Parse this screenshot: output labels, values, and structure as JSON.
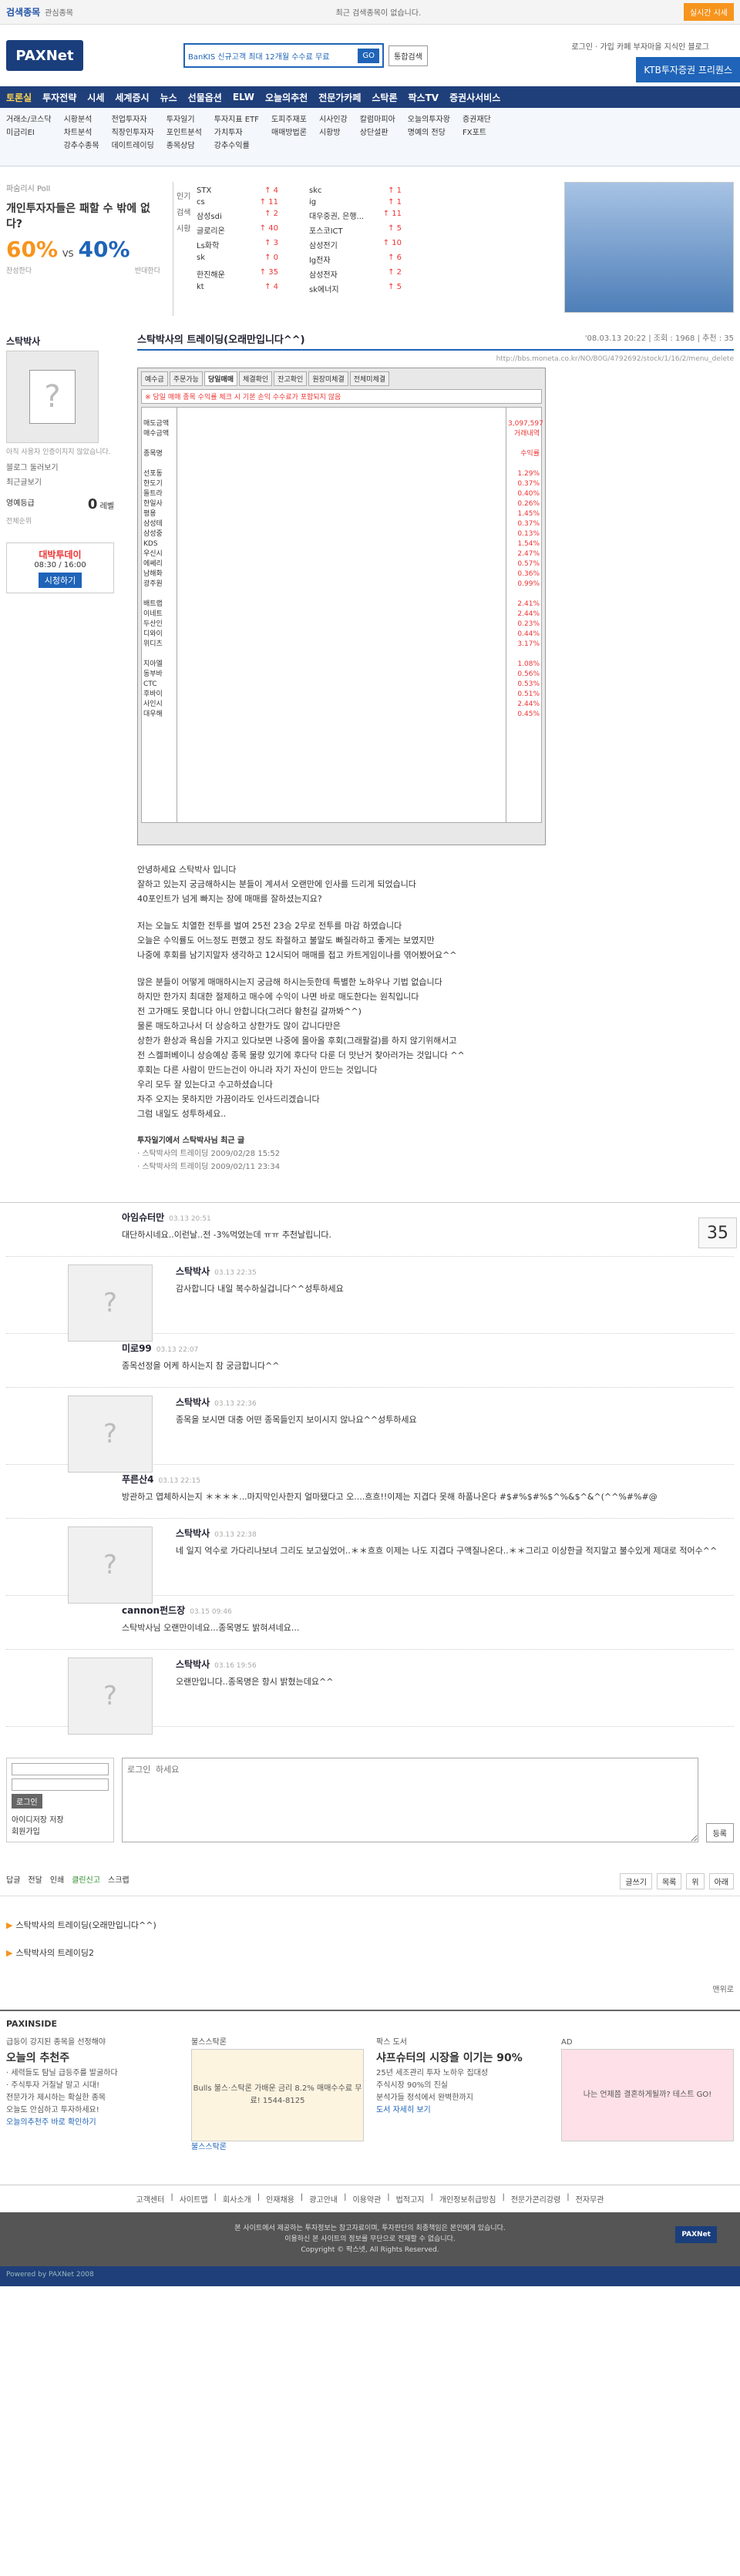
{
  "top": {
    "brand": "검색종목",
    "brand_sub": "관심종목",
    "notice": "최근 검색종목이 없습니다.",
    "right_btn": "실시간 시세"
  },
  "header": {
    "logo": "PAXNet",
    "banner": "BanKIS 신규고객 최대 12개월 수수료 무료",
    "go": "GO",
    "total": "통합검색",
    "links": "로그인 · 가입  카페  부자마을  지식인  블로그",
    "ktb": "KTB투자증권 프리퀀스"
  },
  "nav": [
    "토론실",
    "투자전략",
    "시세",
    "세계증시",
    "뉴스",
    "선물옵션",
    "ELW",
    "오늘의추천",
    "전문가카페",
    "스탁론",
    "팍스TV",
    "증권사서비스"
  ],
  "subnav": [
    [
      "거래소/코스닥",
      "미금리EI"
    ],
    [
      "시황분석",
      "차트분석",
      "강추수종목"
    ],
    [
      "전업투자자",
      "직장인투자자",
      "데이트레이딩"
    ],
    [
      "투자일기",
      "포인트분석",
      "종목상담"
    ],
    [
      "투자지표 ETF",
      "가치투자",
      "강추수익률"
    ],
    [
      "도피주재포",
      "매매방법론"
    ],
    [
      "시사인강",
      "시황방"
    ],
    [
      "칼럼마피아",
      "상단설판"
    ],
    [
      "오늘의투자왕",
      "명예의 전당"
    ],
    [
      "증권재단",
      "FX포트"
    ]
  ],
  "poll": {
    "label": "파숨리시 Poll",
    "question": "개인투자자들은 패할 수 밖에 없다?",
    "a_pct": "60%",
    "vs": "VS",
    "b_pct": "40%",
    "a_cap": "찬성한다",
    "b_cap": "반대한다"
  },
  "rank": {
    "tabs": [
      "인기",
      "검색",
      "시황"
    ],
    "rows": [
      [
        "STX",
        "4",
        "skc",
        "1"
      ],
      [
        "cs",
        "11",
        "ig",
        "1"
      ],
      [
        "삼성sdi",
        "2",
        "대우중권, 은행...",
        "11"
      ],
      [
        "글로리온",
        "40",
        "포스코ICT",
        "5"
      ],
      [
        "Ls화학",
        "3",
        "삼성전기",
        "10"
      ],
      [
        "sk",
        "0",
        "lg전자",
        "6"
      ],
      [
        "한진해운",
        "35",
        "삼성전자",
        "2"
      ],
      [
        "kt",
        "4",
        "sk에너지",
        "5"
      ]
    ]
  },
  "side": {
    "name": "스탁박사",
    "intro": "아직 사용자 인증이지지 않았습니다.",
    "blog": "블로그 둘러보기",
    "recent": "최근글보기",
    "level_label": "영예등급",
    "level": "0",
    "level_unit": "레벨",
    "level_note": "전체순위",
    "tv_title": "대박투데이",
    "tv_time": "08:30 / 16:00",
    "tv_btn": "시청하기"
  },
  "post": {
    "title": "스탁박사의 트레이딩(오래만입니다^^)",
    "date": "'08.03.13 20:22",
    "views": "조회 : 1968",
    "reco": "추천 : 35",
    "url": "http://bbs.moneta.co.kr/NO/B0G/4792692/stock/1/16/2/menu_delete"
  },
  "screen": {
    "tabs": [
      "예수금",
      "주문가능",
      "당일매매",
      "체결확인",
      "잔고확인",
      "원장미체결",
      "전체미체결"
    ],
    "toolbar": "※ 당일 매매 종목 수익률 체크 시 기본 손익 수수료가 포함되지 않음",
    "names": [
      "",
      "매도금액",
      "매수금액",
      "",
      "종목명",
      "",
      "선포동",
      "한도기",
      "돌트라",
      "한일사",
      "평용",
      "삼성테",
      "삼성중",
      "KDS",
      "우신시",
      "에쎄리",
      "남해화",
      "광주원",
      "",
      "배트랩",
      "이네트",
      "두산인",
      "디와이",
      "위디츠",
      "",
      "지아엘",
      "동부바",
      "CTC",
      "후바이",
      "사인시",
      "대우해"
    ],
    "vals": [
      "",
      "3,097,597",
      "거래내역",
      "",
      "수익률",
      "",
      "1.29%",
      "0.37%",
      "0.40%",
      "0.26%",
      "1.45%",
      "0.37%",
      "0.13%",
      "1.54%",
      "2.47%",
      "0.57%",
      "0.36%",
      "0.99%",
      "",
      "2.41%",
      "2.44%",
      "0.23%",
      "0.44%",
      "3.17%",
      "",
      "1.08%",
      "0.56%",
      "0.53%",
      "0.51%",
      "2.44%",
      "0.45%"
    ]
  },
  "body": [
    "안녕하세요 스탁박사 입니다\n잘하고 있는지 궁금해하시는 분들이 계셔서 오랜만에 인사를 드리게 되었습니다\n40포인트가 넘게 빠지는 장에 매매를 잘하셨는지요?",
    "저는 오늘도 치열한 전투를 벌여 25전 23승 2무로 전투를 마감 하였습니다\n오늘은 수익률도 어느정도 편했고 장도 좌절하고 불말도 빠질라하고 좋게는 보였지만\n나중에 후회를 남기지말자 생각하고 12시되어 매매를 접고 카트게임이나를 엮어봤어요^^",
    "많은 분들이 어떻게 매매하시는지 궁금해 하시는듯한데 특별한 노하우나 기법 없습니다\n하지만 한가지 최대한 절제하고 매수에 수익이 나면 바로 매도한다는 원칙입니다\n전 고가매도 못합니다 아니 안합니다(그러다 황천길 갈까봐^^)\n물론 매도하고나서 더 상승하고 상한가도 많이 갑니다만은\n상한가 환상과 욕심을 가지고 있다보면 나중에 몰아올 후회(그래팔걸)를 하지 않기위해서고\n전 스켈퍼베이니 상승예상 종목 물량 있기에 후다닥 다룬 더 맛난거 찾아러가는 것입니다 ^^\n후회는 다른 사람이 만드는건이 아니라 자기 자신이 만드는 것입니다\n우리 모두 잘 있는다고 수고하셨습니다\n자주 오지는 못하지만 가끔이라도 인사드리겠습니다\n그럼 내일도 성투하세요.."
  ],
  "related": {
    "head": "투자일기에서 스탁박사님 최근 글",
    "items": [
      [
        "스탁박사의 트레이딩",
        "2009/02/28 15:52"
      ],
      [
        "스탁박사의 트레이딩",
        "2009/02/11 23:34"
      ]
    ]
  },
  "reco_count": "35",
  "comments": [
    {
      "who": "아임슈터만",
      "dt": "03.13 20:51",
      "tx": "대단하시네요..이런날..전 -3%먹었는데 ㅠㅠ 추천날립니다.",
      "reply": false
    },
    {
      "who": "스탁박사",
      "dt": "03.13 22:35",
      "tx": "감사합니다 내일 복수하실겁니다^^성투하세요",
      "reply": true
    },
    {
      "who": "미로99",
      "dt": "03.13 22:07",
      "tx": "종목선정을 어케 하시는지 참 궁금합니다^^",
      "reply": false
    },
    {
      "who": "스탁박사",
      "dt": "03.13 22:36",
      "tx": "종목을 보시면 대충 어떤 종목들인지 보이시지 않나요^^성투하세요",
      "reply": true
    },
    {
      "who": "푸른산4",
      "dt": "03.13 22:15",
      "tx": "방관하고 엽체하시는지 ＊＊＊＊...마지막인사한지 얼마됐다고 오....흐흐!!이제는 지겹다 못해 하품나온다 #$#%$#%$^%&$^&^(^^%#%#@",
      "reply": false
    },
    {
      "who": "스탁박사",
      "dt": "03.13 22:38",
      "tx": "네 일지 억수로 가다리나보녀 그리도 보고싶었어..＊＊흐흐 이제는 나도 지겹다 구액질나온다..＊＊그리고 이상한글 적지말고 불수있게 제대로 적어수^^",
      "reply": true
    },
    {
      "who": "cannon펀드장",
      "dt": "03.15 09:46",
      "tx": "스탁박사님 오랜만이네요...종목명도 밝혀셔네요...",
      "reply": false
    },
    {
      "who": "스탁박사",
      "dt": "03.16 19:56",
      "tx": "오랜만입니다..종목명은 항시 밝혔는데요^^",
      "reply": true
    }
  ],
  "write": {
    "placeholder": "로그인 하세요",
    "login_btn": "로그인",
    "auto": "아이디저장",
    "save": "저장",
    "join": "회원가입",
    "submit": "등록"
  },
  "actions": [
    "답글",
    "전달",
    "인쇄",
    "클린신고",
    "스크랩"
  ],
  "actions_right": [
    "글쓰기",
    "목록",
    "위",
    "아래"
  ],
  "prevnext": [
    "스탁박사의 트레이딩(오래만입니다^^)",
    "스탁박사의 트레이딩2"
  ],
  "top_label": "맨위로",
  "inside": {
    "head": "PAXINSIDE",
    "c1": {
      "tag": "급등이 강지된 종목을 선정해야",
      "title": "오늘의 추천주",
      "l1": "· 세력들도 탐닐 급등주를 발굴하다",
      "l2": "· 주식투자 거칠날 말고 시대!",
      "l3": "전문가가 제시하는 확실한 종목",
      "l4": "오늘도 안심하고 투자하세요!",
      "link": "오늘의추천주 바로 확인하기"
    },
    "c2": {
      "tag": "불스스탁론",
      "ad": "Bulls 불스·스탁론 가배운 금리 8.2% 매매수수료 무료! 1544-8125",
      "link": "불스스탁론"
    },
    "c3": {
      "tag": "팍스 도서",
      "title": "샤프슈터의 시장을 이기는 90%",
      "l1": "25년 세조관리 투자 노하우 집대성",
      "l2": "주식시장 90%의 진실",
      "l3": "분석가들 정석에서 완벽한까지",
      "link": "도서 자세히 보기"
    },
    "c4": {
      "tag": "AD",
      "ad": "나는 언제쯤 결혼하게될까? 테스트 GO!"
    }
  },
  "footer": [
    "고객센터",
    "사이트맵",
    "회사소개",
    "인재채용",
    "광고안내",
    "이용약관",
    "법적고지",
    "개인정보취급방침",
    "전문가콘리강령",
    "전자무관"
  ],
  "copyright": [
    "본 사이트에서 제공하는 투자정보는 참고자료이며, 투자판단의 최종책임은 본인에게 있습니다.",
    "이용하신 본 사이트의 정보를 무단으로 전재할 수 없습니다.",
    "Copyright © 팍스넷, All Rights Reserved."
  ],
  "bottom": "Powered by PAXNet 2008"
}
